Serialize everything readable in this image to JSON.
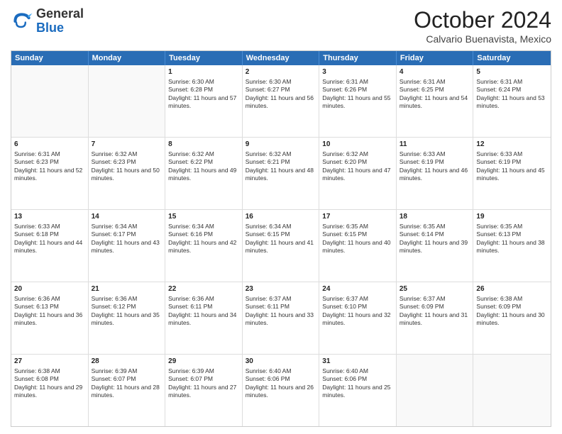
{
  "header": {
    "logo_general": "General",
    "logo_blue": "Blue",
    "month_title": "October 2024",
    "subtitle": "Calvario Buenavista, Mexico"
  },
  "days": [
    "Sunday",
    "Monday",
    "Tuesday",
    "Wednesday",
    "Thursday",
    "Friday",
    "Saturday"
  ],
  "rows": [
    [
      {
        "day": "",
        "info": ""
      },
      {
        "day": "",
        "info": ""
      },
      {
        "day": "1",
        "info": "Sunrise: 6:30 AM\nSunset: 6:28 PM\nDaylight: 11 hours and 57 minutes."
      },
      {
        "day": "2",
        "info": "Sunrise: 6:30 AM\nSunset: 6:27 PM\nDaylight: 11 hours and 56 minutes."
      },
      {
        "day": "3",
        "info": "Sunrise: 6:31 AM\nSunset: 6:26 PM\nDaylight: 11 hours and 55 minutes."
      },
      {
        "day": "4",
        "info": "Sunrise: 6:31 AM\nSunset: 6:25 PM\nDaylight: 11 hours and 54 minutes."
      },
      {
        "day": "5",
        "info": "Sunrise: 6:31 AM\nSunset: 6:24 PM\nDaylight: 11 hours and 53 minutes."
      }
    ],
    [
      {
        "day": "6",
        "info": "Sunrise: 6:31 AM\nSunset: 6:23 PM\nDaylight: 11 hours and 52 minutes."
      },
      {
        "day": "7",
        "info": "Sunrise: 6:32 AM\nSunset: 6:23 PM\nDaylight: 11 hours and 50 minutes."
      },
      {
        "day": "8",
        "info": "Sunrise: 6:32 AM\nSunset: 6:22 PM\nDaylight: 11 hours and 49 minutes."
      },
      {
        "day": "9",
        "info": "Sunrise: 6:32 AM\nSunset: 6:21 PM\nDaylight: 11 hours and 48 minutes."
      },
      {
        "day": "10",
        "info": "Sunrise: 6:32 AM\nSunset: 6:20 PM\nDaylight: 11 hours and 47 minutes."
      },
      {
        "day": "11",
        "info": "Sunrise: 6:33 AM\nSunset: 6:19 PM\nDaylight: 11 hours and 46 minutes."
      },
      {
        "day": "12",
        "info": "Sunrise: 6:33 AM\nSunset: 6:19 PM\nDaylight: 11 hours and 45 minutes."
      }
    ],
    [
      {
        "day": "13",
        "info": "Sunrise: 6:33 AM\nSunset: 6:18 PM\nDaylight: 11 hours and 44 minutes."
      },
      {
        "day": "14",
        "info": "Sunrise: 6:34 AM\nSunset: 6:17 PM\nDaylight: 11 hours and 43 minutes."
      },
      {
        "day": "15",
        "info": "Sunrise: 6:34 AM\nSunset: 6:16 PM\nDaylight: 11 hours and 42 minutes."
      },
      {
        "day": "16",
        "info": "Sunrise: 6:34 AM\nSunset: 6:15 PM\nDaylight: 11 hours and 41 minutes."
      },
      {
        "day": "17",
        "info": "Sunrise: 6:35 AM\nSunset: 6:15 PM\nDaylight: 11 hours and 40 minutes."
      },
      {
        "day": "18",
        "info": "Sunrise: 6:35 AM\nSunset: 6:14 PM\nDaylight: 11 hours and 39 minutes."
      },
      {
        "day": "19",
        "info": "Sunrise: 6:35 AM\nSunset: 6:13 PM\nDaylight: 11 hours and 38 minutes."
      }
    ],
    [
      {
        "day": "20",
        "info": "Sunrise: 6:36 AM\nSunset: 6:13 PM\nDaylight: 11 hours and 36 minutes."
      },
      {
        "day": "21",
        "info": "Sunrise: 6:36 AM\nSunset: 6:12 PM\nDaylight: 11 hours and 35 minutes."
      },
      {
        "day": "22",
        "info": "Sunrise: 6:36 AM\nSunset: 6:11 PM\nDaylight: 11 hours and 34 minutes."
      },
      {
        "day": "23",
        "info": "Sunrise: 6:37 AM\nSunset: 6:11 PM\nDaylight: 11 hours and 33 minutes."
      },
      {
        "day": "24",
        "info": "Sunrise: 6:37 AM\nSunset: 6:10 PM\nDaylight: 11 hours and 32 minutes."
      },
      {
        "day": "25",
        "info": "Sunrise: 6:37 AM\nSunset: 6:09 PM\nDaylight: 11 hours and 31 minutes."
      },
      {
        "day": "26",
        "info": "Sunrise: 6:38 AM\nSunset: 6:09 PM\nDaylight: 11 hours and 30 minutes."
      }
    ],
    [
      {
        "day": "27",
        "info": "Sunrise: 6:38 AM\nSunset: 6:08 PM\nDaylight: 11 hours and 29 minutes."
      },
      {
        "day": "28",
        "info": "Sunrise: 6:39 AM\nSunset: 6:07 PM\nDaylight: 11 hours and 28 minutes."
      },
      {
        "day": "29",
        "info": "Sunrise: 6:39 AM\nSunset: 6:07 PM\nDaylight: 11 hours and 27 minutes."
      },
      {
        "day": "30",
        "info": "Sunrise: 6:40 AM\nSunset: 6:06 PM\nDaylight: 11 hours and 26 minutes."
      },
      {
        "day": "31",
        "info": "Sunrise: 6:40 AM\nSunset: 6:06 PM\nDaylight: 11 hours and 25 minutes."
      },
      {
        "day": "",
        "info": ""
      },
      {
        "day": "",
        "info": ""
      }
    ]
  ]
}
